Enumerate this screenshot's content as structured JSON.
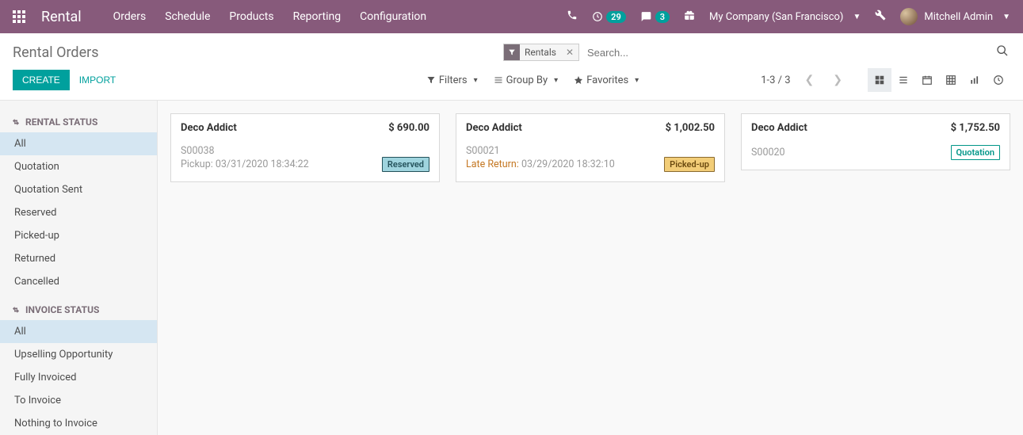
{
  "topbar": {
    "brand": "Rental",
    "menu": [
      "Orders",
      "Schedule",
      "Products",
      "Reporting",
      "Configuration"
    ],
    "clock_badge": "29",
    "chat_badge": "3",
    "company": "My Company (San Francisco)",
    "user": "Mitchell Admin"
  },
  "control": {
    "title": "Rental Orders",
    "facet_label": "Rentals",
    "search_placeholder": "Search...",
    "create_label": "Create",
    "import_label": "Import",
    "filters_label": "Filters",
    "groupby_label": "Group By",
    "favorites_label": "Favorites",
    "pager_text": "1-3 / 3"
  },
  "sidebar": {
    "sections": [
      {
        "title": "Rental Status",
        "items": [
          "All",
          "Quotation",
          "Quotation Sent",
          "Reserved",
          "Picked-up",
          "Returned",
          "Cancelled"
        ],
        "active": 0
      },
      {
        "title": "Invoice Status",
        "items": [
          "All",
          "Upselling Opportunity",
          "Fully Invoiced",
          "To Invoice",
          "Nothing to Invoice"
        ],
        "active": 0
      }
    ]
  },
  "cards": [
    {
      "customer": "Deco Addict",
      "amount": "$ 690.00",
      "order": "S00038",
      "detail_label": "Pickup:",
      "detail_date": "03/31/2020 18:34:22",
      "detail_late": false,
      "tag": "Reserved",
      "tag_class": "reserved"
    },
    {
      "customer": "Deco Addict",
      "amount": "$ 1,002.50",
      "order": "S00021",
      "detail_label": "Late Return:",
      "detail_date": "03/29/2020 18:32:10",
      "detail_late": true,
      "tag": "Picked-up",
      "tag_class": "pickedup"
    },
    {
      "customer": "Deco Addict",
      "amount": "$ 1,752.50",
      "order": "S00020",
      "detail_label": "",
      "detail_date": "",
      "detail_late": false,
      "tag": "Quotation",
      "tag_class": "quotation"
    }
  ]
}
